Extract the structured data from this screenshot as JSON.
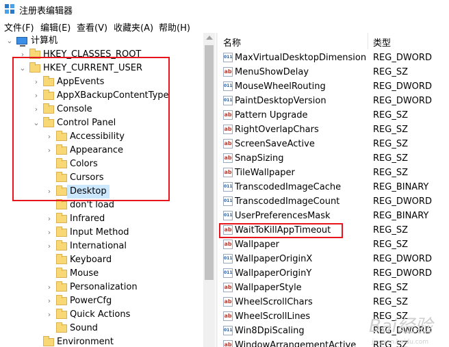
{
  "window": {
    "title": "注册表编辑器"
  },
  "menu": [
    "文件(F)",
    "编辑(E)",
    "查看(V)",
    "收藏夹(A)",
    "帮助(H)"
  ],
  "tree": {
    "root": "计算机",
    "items": [
      {
        "label": "HKEY_CLASSES_ROOT",
        "depth": 1,
        "expander": "›"
      },
      {
        "label": "HKEY_CURRENT_USER",
        "depth": 1,
        "expander": "⌄"
      },
      {
        "label": "AppEvents",
        "depth": 2,
        "expander": "›"
      },
      {
        "label": "AppXBackupContentType",
        "depth": 2,
        "expander": "›"
      },
      {
        "label": "Console",
        "depth": 2,
        "expander": "›"
      },
      {
        "label": "Control Panel",
        "depth": 2,
        "expander": "⌄"
      },
      {
        "label": "Accessibility",
        "depth": 3,
        "expander": "›"
      },
      {
        "label": "Appearance",
        "depth": 3,
        "expander": "›"
      },
      {
        "label": "Colors",
        "depth": 3,
        "expander": ""
      },
      {
        "label": "Cursors",
        "depth": 3,
        "expander": ""
      },
      {
        "label": "Desktop",
        "depth": 3,
        "expander": "›",
        "selected": true
      },
      {
        "label": "don't load",
        "depth": 3,
        "expander": ""
      },
      {
        "label": "Infrared",
        "depth": 3,
        "expander": "›"
      },
      {
        "label": "Input Method",
        "depth": 3,
        "expander": "›"
      },
      {
        "label": "International",
        "depth": 3,
        "expander": "›"
      },
      {
        "label": "Keyboard",
        "depth": 3,
        "expander": ""
      },
      {
        "label": "Mouse",
        "depth": 3,
        "expander": ""
      },
      {
        "label": "Personalization",
        "depth": 3,
        "expander": "›"
      },
      {
        "label": "PowerCfg",
        "depth": 3,
        "expander": "›"
      },
      {
        "label": "Quick Actions",
        "depth": 3,
        "expander": "›"
      },
      {
        "label": "Sound",
        "depth": 3,
        "expander": ""
      },
      {
        "label": "Environment",
        "depth": 2,
        "expander": ""
      }
    ]
  },
  "list": {
    "columns": {
      "name": "名称",
      "type": "类型"
    },
    "rows": [
      {
        "name": "MaxVirtualDesktopDimension",
        "type": "REG_DWORD",
        "icon": "binary-value-icon"
      },
      {
        "name": "MenuShowDelay",
        "type": "REG_SZ",
        "icon": "string-value-icon"
      },
      {
        "name": "MouseWheelRouting",
        "type": "REG_DWORD",
        "icon": "binary-value-icon"
      },
      {
        "name": "PaintDesktopVersion",
        "type": "REG_DWORD",
        "icon": "binary-value-icon"
      },
      {
        "name": "Pattern Upgrade",
        "type": "REG_SZ",
        "icon": "string-value-icon"
      },
      {
        "name": "RightOverlapChars",
        "type": "REG_SZ",
        "icon": "string-value-icon"
      },
      {
        "name": "ScreenSaveActive",
        "type": "REG_SZ",
        "icon": "string-value-icon"
      },
      {
        "name": "SnapSizing",
        "type": "REG_SZ",
        "icon": "string-value-icon"
      },
      {
        "name": "TileWallpaper",
        "type": "REG_SZ",
        "icon": "string-value-icon"
      },
      {
        "name": "TranscodedImageCache",
        "type": "REG_BINARY",
        "icon": "binary-value-icon"
      },
      {
        "name": "TranscodedImageCount",
        "type": "REG_DWORD",
        "icon": "binary-value-icon"
      },
      {
        "name": "UserPreferencesMask",
        "type": "REG_BINARY",
        "icon": "binary-value-icon"
      },
      {
        "name": "WaitToKillAppTimeout",
        "type": "REG_SZ",
        "icon": "string-value-icon"
      },
      {
        "name": "Wallpaper",
        "type": "REG_SZ",
        "icon": "string-value-icon"
      },
      {
        "name": "WallpaperOriginX",
        "type": "REG_DWORD",
        "icon": "binary-value-icon"
      },
      {
        "name": "WallpaperOriginY",
        "type": "REG_DWORD",
        "icon": "binary-value-icon"
      },
      {
        "name": "WallpaperStyle",
        "type": "REG_SZ",
        "icon": "string-value-icon"
      },
      {
        "name": "WheelScrollChars",
        "type": "REG_SZ",
        "icon": "string-value-icon"
      },
      {
        "name": "WheelScrollLines",
        "type": "REG_SZ",
        "icon": "string-value-icon"
      },
      {
        "name": "Win8DpiScaling",
        "type": "REG_DWORD",
        "icon": "binary-value-icon"
      },
      {
        "name": "WindowArrangementActive",
        "type": "REG_SZ",
        "icon": "string-value-icon"
      }
    ]
  },
  "icons": {
    "string": "ab",
    "binary": "011"
  },
  "colors": {
    "highlight": "#e8141c",
    "selection": "#cce8ff"
  },
  "watermark": {
    "main": "Bai经验",
    "sub": "jingyan.baidu.com"
  }
}
